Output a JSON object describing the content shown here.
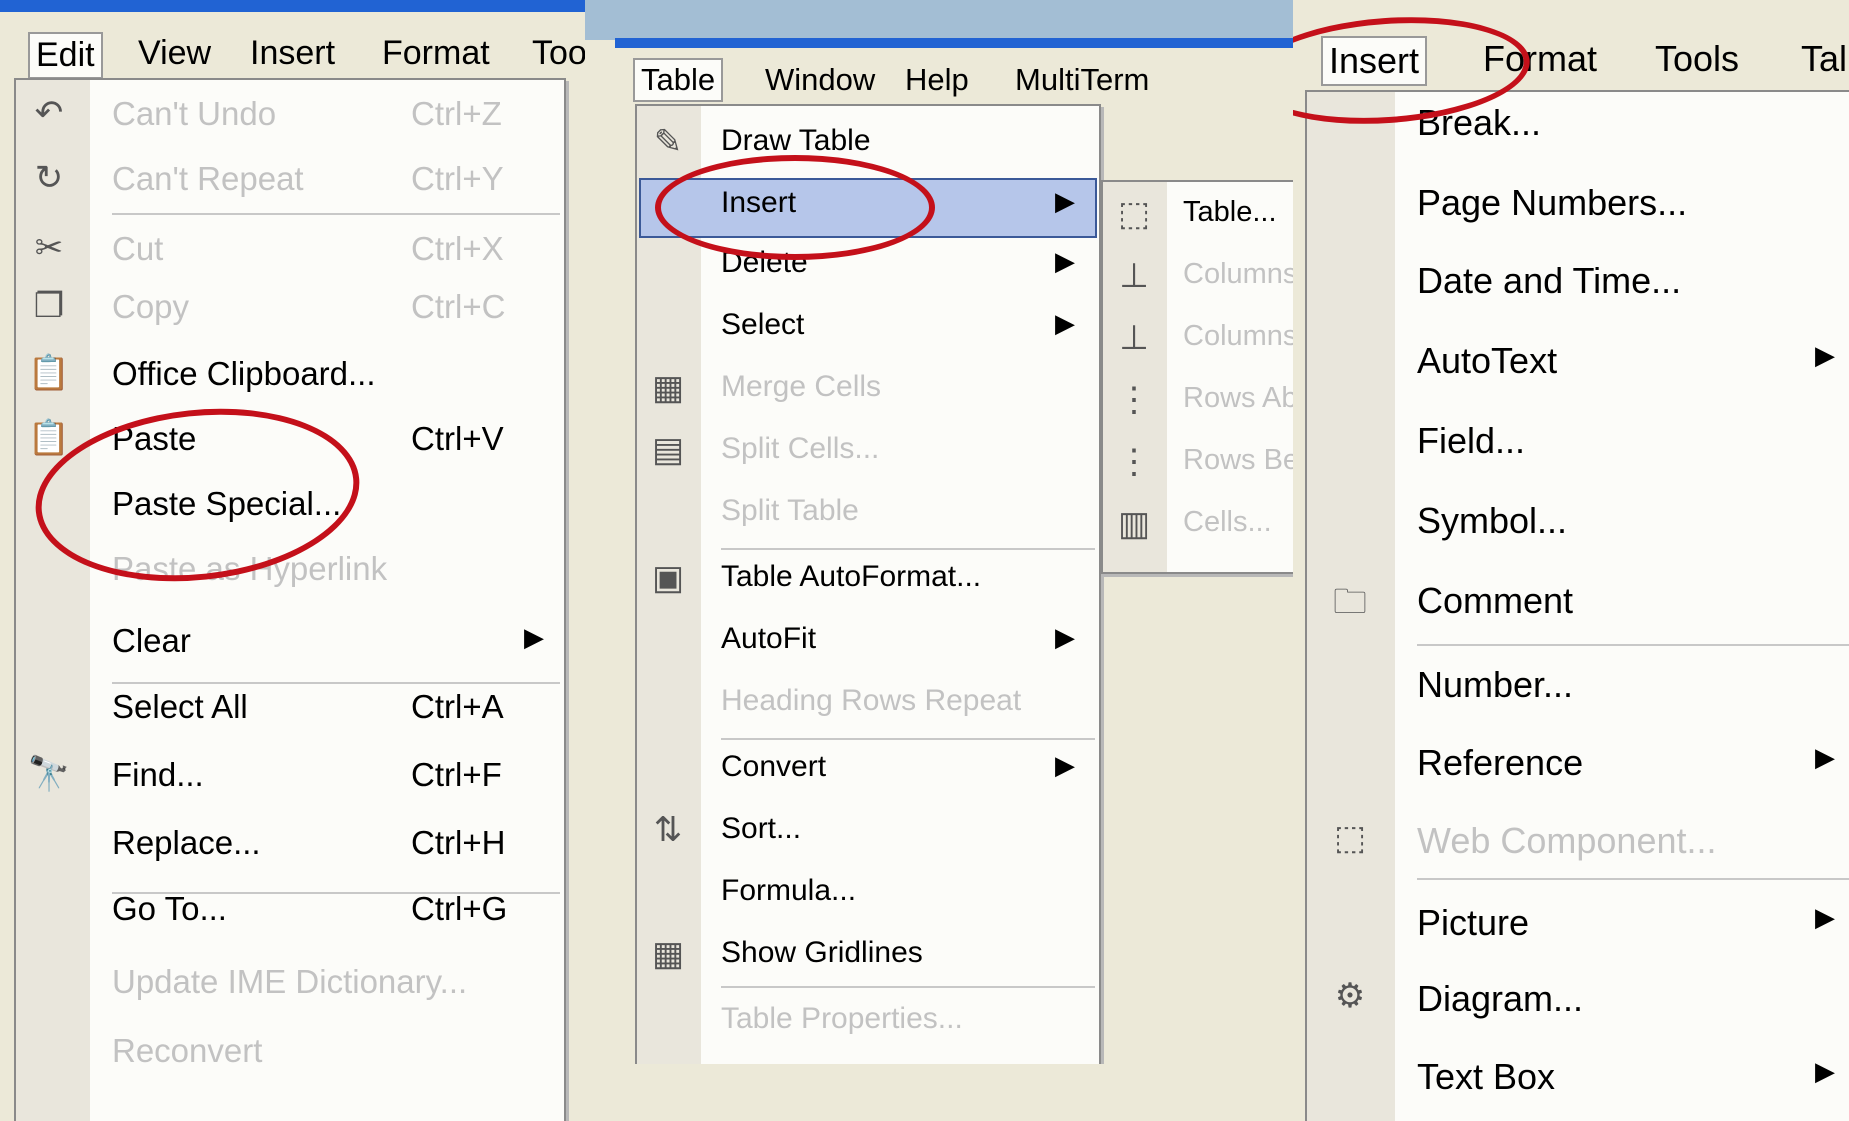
{
  "edit_panel": {
    "menubar": [
      "Edit",
      "View",
      "Insert",
      "Format",
      "Too"
    ],
    "items": [
      {
        "label": "Can't Undo",
        "shortcut": "Ctrl+Z",
        "disabled": true,
        "icon": "undo-icon"
      },
      {
        "label": "Can't Repeat",
        "shortcut": "Ctrl+Y",
        "disabled": true,
        "icon": "repeat-icon"
      },
      {
        "label": "Cut",
        "shortcut": "Ctrl+X",
        "disabled": true,
        "icon": "scissors-icon"
      },
      {
        "label": "Copy",
        "shortcut": "Ctrl+C",
        "disabled": true,
        "icon": "copy-icon"
      },
      {
        "label": "Office Clipboard...",
        "shortcut": "",
        "disabled": false,
        "icon": "clipboard-icon"
      },
      {
        "label": "Paste",
        "shortcut": "Ctrl+V",
        "disabled": false,
        "icon": "paste-icon"
      },
      {
        "label": "Paste Special...",
        "shortcut": "",
        "disabled": false
      },
      {
        "label": "Paste as Hyperlink",
        "shortcut": "",
        "disabled": true
      },
      {
        "label": "Clear",
        "shortcut": "",
        "disabled": false,
        "submenu": true
      },
      {
        "label": "Select All",
        "shortcut": "Ctrl+A",
        "disabled": false
      },
      {
        "label": "Find...",
        "shortcut": "Ctrl+F",
        "disabled": false,
        "icon": "binoculars-icon"
      },
      {
        "label": "Replace...",
        "shortcut": "Ctrl+H",
        "disabled": false
      },
      {
        "label": "Go To...",
        "shortcut": "Ctrl+G",
        "disabled": false
      },
      {
        "label": "Update IME Dictionary...",
        "shortcut": "",
        "disabled": true
      },
      {
        "label": "Reconvert",
        "shortcut": "",
        "disabled": true
      }
    ]
  },
  "table_panel": {
    "menubar": [
      "Table",
      "Window",
      "Help",
      "MultiTerm"
    ],
    "items": [
      {
        "label": "Draw Table",
        "disabled": false,
        "icon": "pencil-icon"
      },
      {
        "label": "Insert",
        "disabled": false,
        "submenu": true,
        "highlighted": true
      },
      {
        "label": "Delete",
        "disabled": false,
        "submenu": true
      },
      {
        "label": "Select",
        "disabled": false,
        "submenu": true
      },
      {
        "label": "Merge Cells",
        "disabled": true,
        "icon": "merge-icon"
      },
      {
        "label": "Split Cells...",
        "disabled": true,
        "icon": "split-icon"
      },
      {
        "label": "Split Table",
        "disabled": true
      },
      {
        "label": "Table AutoFormat...",
        "disabled": false,
        "icon": "autoformat-icon"
      },
      {
        "label": "AutoFit",
        "disabled": false,
        "submenu": true
      },
      {
        "label": "Heading Rows Repeat",
        "disabled": true
      },
      {
        "label": "Convert",
        "disabled": false,
        "submenu": true
      },
      {
        "label": "Sort...",
        "disabled": false,
        "icon": "sort-icon"
      },
      {
        "label": "Formula...",
        "disabled": false
      },
      {
        "label": "Show Gridlines",
        "disabled": false,
        "icon": "gridlines-icon"
      },
      {
        "label": "Table Properties...",
        "disabled": true
      }
    ],
    "submenu": [
      {
        "label": "Table...",
        "disabled": false
      },
      {
        "label": "Columns",
        "disabled": true
      },
      {
        "label": "Columns",
        "disabled": true
      },
      {
        "label": "Rows Ab",
        "disabled": true
      },
      {
        "label": "Rows Be",
        "disabled": true
      },
      {
        "label": "Cells...",
        "disabled": true
      }
    ]
  },
  "insert_panel": {
    "menubar": [
      "Insert",
      "Format",
      "Tools",
      "Tal"
    ],
    "items": [
      {
        "label": "Break...",
        "disabled": false
      },
      {
        "label": "Page Numbers...",
        "disabled": false
      },
      {
        "label": "Date and Time...",
        "disabled": false
      },
      {
        "label": "AutoText",
        "disabled": false,
        "submenu": true
      },
      {
        "label": "Field...",
        "disabled": false
      },
      {
        "label": "Symbol...",
        "disabled": false
      },
      {
        "label": "Comment",
        "disabled": false,
        "icon": "comment-icon"
      },
      {
        "label": "Number...",
        "disabled": false
      },
      {
        "label": "Reference",
        "disabled": false,
        "submenu": true
      },
      {
        "label": "Web Component...",
        "disabled": true,
        "icon": "web-component-icon"
      },
      {
        "label": "Picture",
        "disabled": false,
        "submenu": true
      },
      {
        "label": "Diagram...",
        "disabled": false,
        "icon": "diagram-icon"
      },
      {
        "label": "Text Box",
        "disabled": false,
        "submenu": true
      }
    ]
  },
  "colors": {
    "highlight": "#b6c6ea",
    "annotation": "#c4101a",
    "title_bar": "#2163d3"
  }
}
